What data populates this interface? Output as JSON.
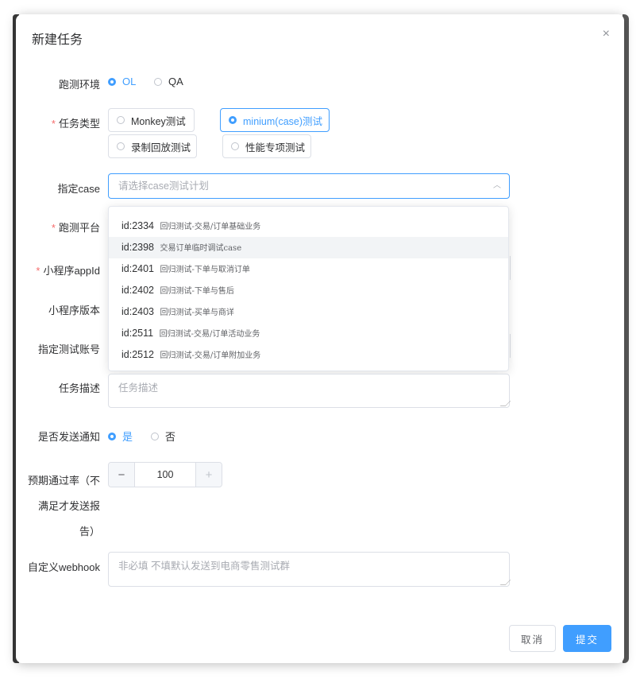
{
  "dialog": {
    "title": "新建任务",
    "close_icon": "×"
  },
  "env": {
    "label": "跑测环境",
    "options": [
      "OL",
      "QA"
    ],
    "selected": "OL"
  },
  "task_type": {
    "label": "任务类型",
    "required": "*",
    "options": [
      "Monkey测试",
      "minium(case)测试",
      "录制回放测试",
      "性能专项测试"
    ],
    "selected": "minium(case)测试"
  },
  "case": {
    "label": "指定case",
    "placeholder": "请选择case测试计划",
    "arrow_icon": "chevron-up-icon",
    "dropdown": [
      {
        "id": "id:2334",
        "name": "回归测试-交易/订单基础业务"
      },
      {
        "id": "id:2398",
        "name": "交易订单临时调试case"
      },
      {
        "id": "id:2401",
        "name": "回归测试-下单与取消订单"
      },
      {
        "id": "id:2402",
        "name": "回归测试-下单与售后"
      },
      {
        "id": "id:2403",
        "name": "回归测试-买单与商详"
      },
      {
        "id": "id:2511",
        "name": "回归测试-交易/订单活动业务"
      },
      {
        "id": "id:2512",
        "name": "回归测试-交易/订单附加业务"
      }
    ],
    "hovered": "id:2398"
  },
  "platform": {
    "label": "跑测平台",
    "required": "*"
  },
  "appid": {
    "label": "小程序appId",
    "required": "*"
  },
  "version": {
    "label": "小程序版本"
  },
  "account": {
    "label": "指定测试账号"
  },
  "desc": {
    "label": "任务描述",
    "placeholder": "任务描述"
  },
  "notify": {
    "label": "是否发送通知",
    "options": [
      "是",
      "否"
    ],
    "selected": "是"
  },
  "pass_rate": {
    "label_lines": [
      "预期通过率（不",
      "满足才发送报",
      "告）"
    ],
    "value": "100",
    "minus": "−",
    "plus": "+"
  },
  "webhook": {
    "label": "自定义webhook",
    "placeholder": "非必填 不填默认发送到电商零售测试群"
  },
  "footer": {
    "cancel": "取消",
    "submit": "提交"
  },
  "colors": {
    "primary": "#409eff",
    "required": "#f56c6c",
    "border": "#dcdfe6"
  }
}
